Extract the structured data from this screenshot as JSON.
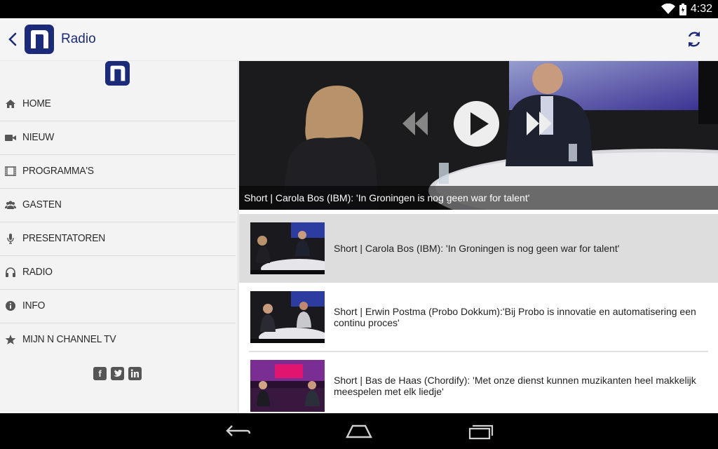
{
  "status_bar": {
    "time": "4:32",
    "icons": [
      "wifi-icon",
      "battery-icon"
    ]
  },
  "app_bar": {
    "title": "Radio",
    "icons": [
      "back-arrow-icon",
      "app-logo",
      "refresh-icon"
    ]
  },
  "sidebar": {
    "items": [
      {
        "label": "HOME",
        "icon": "home-icon"
      },
      {
        "label": "NIEUW",
        "icon": "video-camera-icon"
      },
      {
        "label": "PROGRAMMA'S",
        "icon": "film-icon"
      },
      {
        "label": "GASTEN",
        "icon": "users-icon"
      },
      {
        "label": "PRESENTATOREN",
        "icon": "microphone-icon"
      },
      {
        "label": "RADIO",
        "icon": "headphones-icon"
      },
      {
        "label": "INFO",
        "icon": "info-icon"
      },
      {
        "label": "MIJN N CHANNEL TV",
        "icon": "star-icon"
      }
    ],
    "social": [
      "facebook-icon",
      "twitter-icon",
      "linkedin-icon"
    ]
  },
  "player": {
    "caption": "Short | Carola Bos (IBM): 'In Groningen is nog geen war for talent'"
  },
  "videos": [
    {
      "title": "Short | Carola Bos (IBM): 'In Groningen is nog geen war for talent'",
      "selected": true
    },
    {
      "title": "Short | Erwin Postma (Probo Dokkum):'Bij Probo is innovatie en automatisering een continu proces'",
      "selected": false
    },
    {
      "title": "Short | Bas de Haas (Chordify): 'Met onze dienst kunnen muzikanten heel makkelijk meespelen met elk liedje'",
      "selected": false
    }
  ],
  "colors": {
    "brand": "#1c2a7a",
    "accent": "#2a4aa8"
  }
}
